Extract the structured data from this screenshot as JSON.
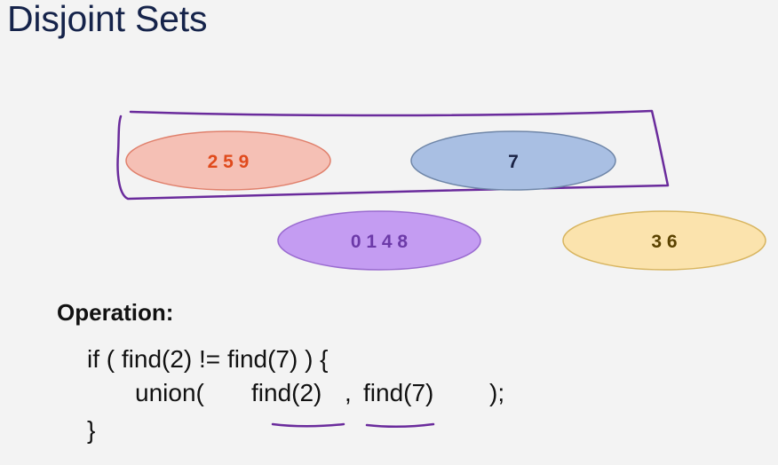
{
  "title": "Disjoint Sets",
  "sets": [
    {
      "label": "2 5 9",
      "fill": "#f5c0b5",
      "stroke": "#e0806c",
      "text_color": "#e04a1c"
    },
    {
      "label": "7",
      "fill": "#a9bfe3",
      "stroke": "#6f86a8",
      "text_color": "#1a2244"
    },
    {
      "label": "0 1 4 8",
      "fill": "#c49cf2",
      "stroke": "#9a6bd0",
      "text_color": "#6c3aa8"
    },
    {
      "label": "3 6",
      "fill": "#fbe3ad",
      "stroke": "#d8b560",
      "text_color": "#5a4200"
    }
  ],
  "annotation_color": "#6a2b9c",
  "operation": {
    "heading": "Operation:",
    "line1": "if ( find(2) != find(7) ) {",
    "line2_start": "union(",
    "line2_arg1": "find(2)",
    "line2_sep": ",",
    "line2_arg2": "find(7)",
    "line2_end": ");",
    "line3": "}"
  }
}
